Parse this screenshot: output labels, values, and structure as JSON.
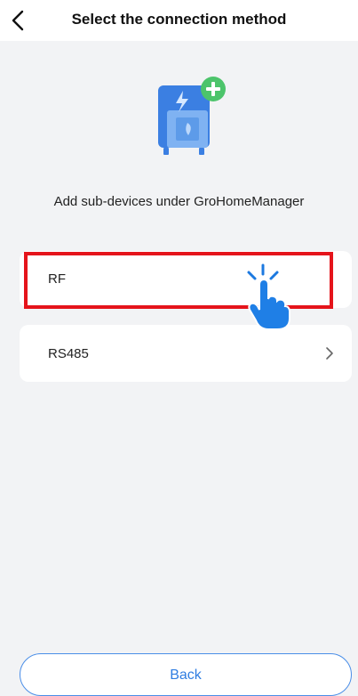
{
  "header": {
    "title": "Select the connection method",
    "back_icon": "chevron-left-icon"
  },
  "hero": {
    "icon": "device-add-icon",
    "accent_color": "#4a8ee8",
    "plus_color": "#4cc46b"
  },
  "description": "Add sub-devices under GroHomeManager",
  "options": [
    {
      "label": "RF",
      "highlighted": true
    },
    {
      "label": "RS485",
      "chevron": "chevron-right-icon"
    }
  ],
  "back_button": {
    "label": "Back"
  },
  "colors": {
    "background": "#f2f3f5",
    "card": "#ffffff",
    "highlight": "#e5141b",
    "link_blue": "#2f7de1"
  }
}
